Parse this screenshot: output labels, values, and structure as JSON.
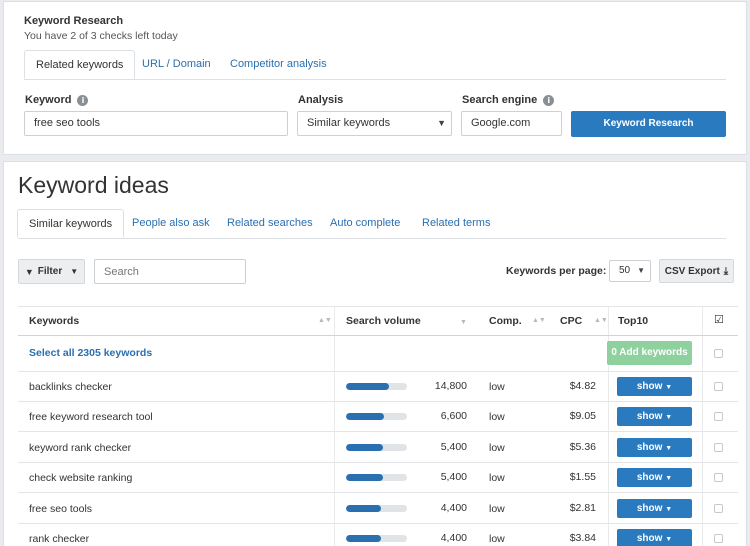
{
  "research": {
    "title": "Keyword Research",
    "checks_left": "You have 2 of 3 checks left today",
    "tabs": [
      "Related keywords",
      "URL / Domain",
      "Competitor analysis"
    ],
    "keyword_label": "Keyword",
    "keyword_value": "free seo tools",
    "analysis_label": "Analysis",
    "analysis_value": "Similar keywords",
    "engine_label": "Search engine",
    "engine_value": "Google.com",
    "submit_label": "Keyword Research"
  },
  "ideas": {
    "title": "Keyword ideas",
    "tabs": [
      "Similar keywords",
      "People also ask",
      "Related searches",
      "Auto complete",
      "Related terms"
    ],
    "filter_label": "Filter",
    "search_placeholder": "Search",
    "per_page_label": "Keywords per page:",
    "per_page_value": "50",
    "export_label": "CSV Export"
  },
  "table": {
    "headers": {
      "keywords": "Keywords",
      "volume": "Search volume",
      "comp": "Comp.",
      "cpc": "CPC",
      "top10": "Top10"
    },
    "select_all": "Select all 2305 keywords",
    "add_label": "0 Add keywords",
    "show_label": "show",
    "rows": [
      {
        "keyword": "backlinks checker",
        "volume": "14,800",
        "level": 0.7,
        "comp": "low",
        "cpc": "$4.82"
      },
      {
        "keyword": "free keyword research tool",
        "volume": "6,600",
        "level": 0.62,
        "comp": "low",
        "cpc": "$9.05"
      },
      {
        "keyword": "keyword rank checker",
        "volume": "5,400",
        "level": 0.6,
        "comp": "low",
        "cpc": "$5.36"
      },
      {
        "keyword": "check website ranking",
        "volume": "5,400",
        "level": 0.6,
        "comp": "low",
        "cpc": "$1.55"
      },
      {
        "keyword": "free seo tools",
        "volume": "4,400",
        "level": 0.58,
        "comp": "low",
        "cpc": "$2.81"
      },
      {
        "keyword": "rank checker",
        "volume": "4,400",
        "level": 0.58,
        "comp": "low",
        "cpc": "$3.84"
      }
    ]
  },
  "colors": {
    "accent": "#2a7ac0",
    "link": "#2a6fb0",
    "success": "#8fd19e"
  }
}
